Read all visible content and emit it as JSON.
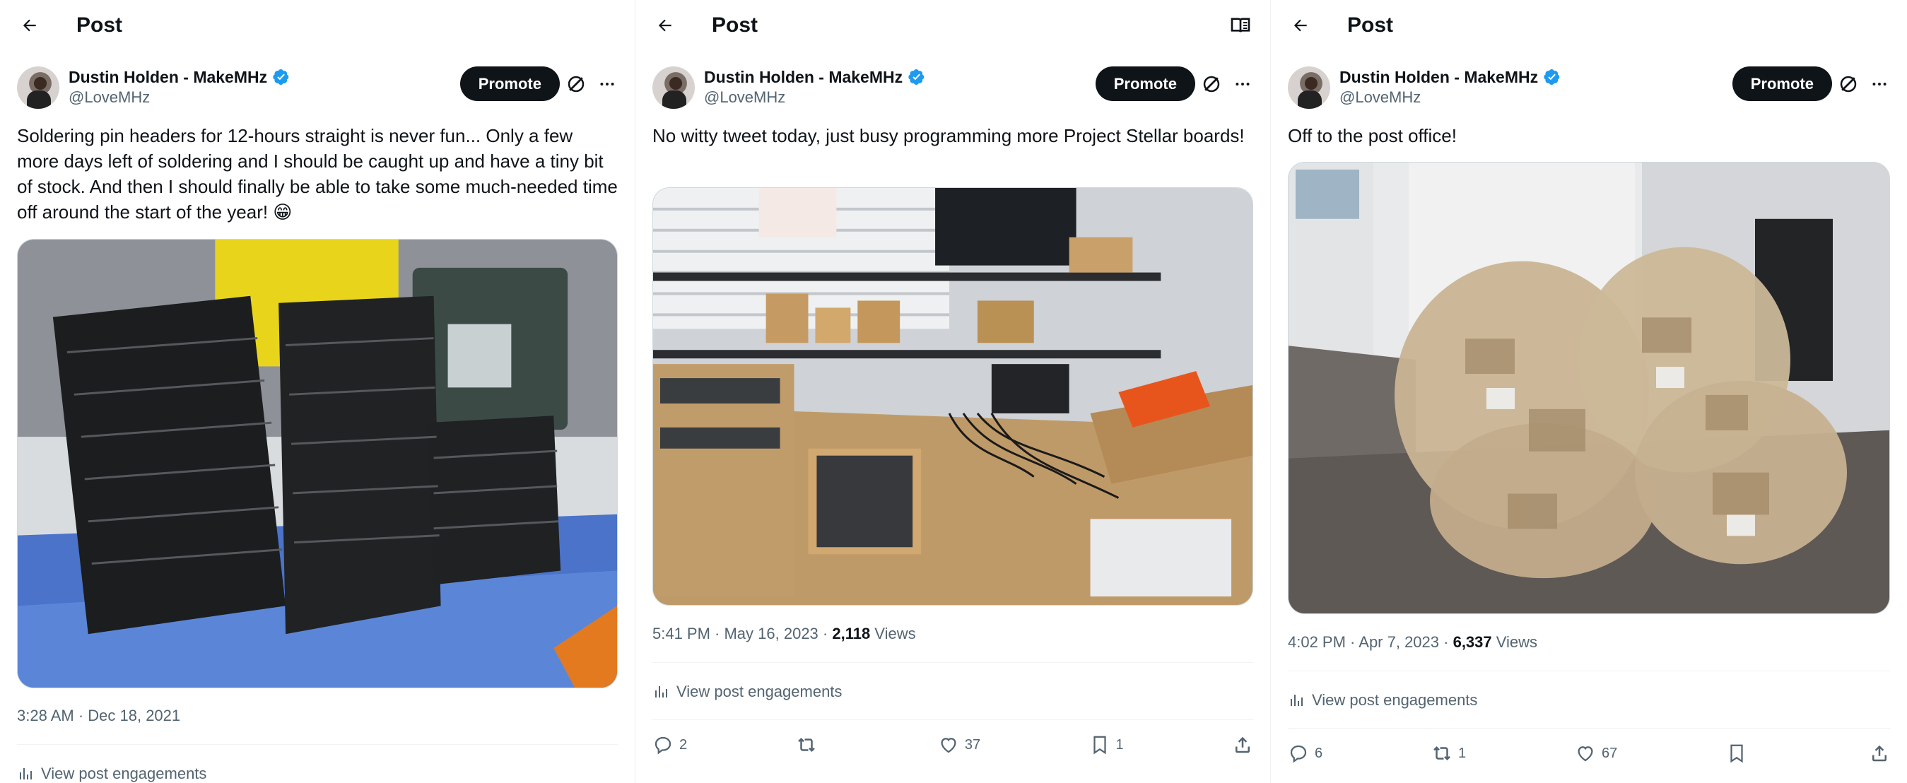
{
  "columns": [
    {
      "header": {
        "title": "Post"
      },
      "author": {
        "name": "Dustin Holden - MakeMHz",
        "handle": "@LoveMHz"
      },
      "promote_label": "Promote",
      "text": "Soldering pin headers for 12-hours straight is never fun... Only a few more days left of soldering and I should be caught up and have a tiny bit of stock. And then I should finally be able to take some much-needed time off around the start of the year! 😁",
      "image_icon": "photo-soldered-boards",
      "timestamp": "3:28 AM · Dec 18, 2021",
      "view_engagements_label": "View post engagements"
    },
    {
      "header": {
        "title": "Post"
      },
      "author": {
        "name": "Dustin Holden - MakeMHz",
        "handle": "@LoveMHz"
      },
      "promote_label": "Promote",
      "text": "No witty tweet today, just busy programming more Project Stellar boards!",
      "image_icon": "photo-workbench",
      "timestamp": "5:41 PM · May 16, 2023 · ",
      "views_count": "2,118",
      "views_label": " Views",
      "view_engagements_label": "View post engagements",
      "counts": {
        "replies": "2",
        "reposts": "",
        "likes": "37",
        "bookmarks": "1"
      }
    },
    {
      "header": {
        "title": "Post"
      },
      "author": {
        "name": "Dustin Holden - MakeMHz",
        "handle": "@LoveMHz"
      },
      "promote_label": "Promote",
      "text": "Off to the post office!",
      "image_icon": "photo-package-bags",
      "timestamp": "4:02 PM · Apr 7, 2023 · ",
      "views_count": "6,337",
      "views_label": " Views",
      "view_engagements_label": "View post engagements",
      "counts": {
        "replies": "6",
        "reposts": "1",
        "likes": "67",
        "bookmarks": ""
      }
    }
  ],
  "colors": {
    "text": "#0f1419",
    "muted": "#536471",
    "verified": "#1d9bf0",
    "divider": "#eff3f4"
  }
}
